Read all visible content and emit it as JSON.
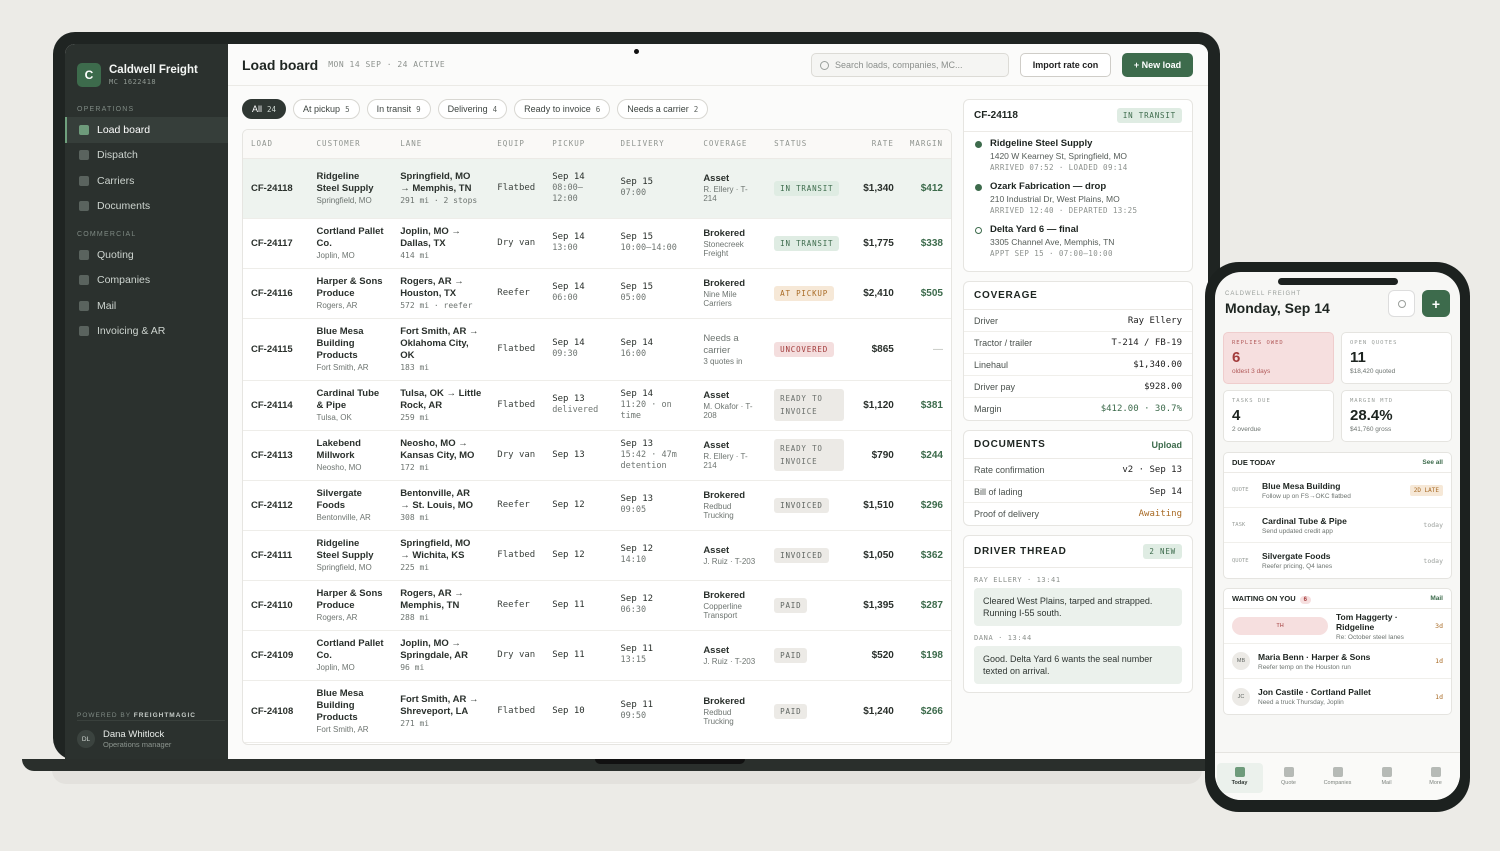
{
  "brand": {
    "name": "Caldwell Freight",
    "sub": "MC 1622418",
    "logo": "C"
  },
  "sidebar": {
    "sections": [
      {
        "label": "OPERATIONS",
        "items": [
          {
            "label": "Load board",
            "active": true
          },
          {
            "label": "Dispatch"
          },
          {
            "label": "Carriers"
          },
          {
            "label": "Documents"
          }
        ]
      },
      {
        "label": "COMMERCIAL",
        "items": [
          {
            "label": "Quoting"
          },
          {
            "label": "Companies"
          },
          {
            "label": "Mail"
          },
          {
            "label": "Invoicing & AR"
          }
        ]
      }
    ],
    "powered_prefix": "POWERED BY",
    "powered_name": "FREIGHTMAGIC",
    "user": {
      "initials": "DL",
      "name": "Dana Whitlock",
      "role": "Operations manager"
    }
  },
  "header": {
    "title": "Load board",
    "meta": "MON 14 SEP · 24 ACTIVE",
    "search_placeholder": "Search loads, companies, MC...",
    "import_label": "Import rate con",
    "new_label": "+ New load"
  },
  "filters": [
    {
      "label": "All",
      "count": "24",
      "active": true
    },
    {
      "label": "At pickup",
      "count": "5"
    },
    {
      "label": "In transit",
      "count": "9"
    },
    {
      "label": "Delivering",
      "count": "4"
    },
    {
      "label": "Ready to invoice",
      "count": "6"
    },
    {
      "label": "Needs a carrier",
      "count": "2"
    }
  ],
  "table": {
    "columns": [
      "LOAD",
      "CUSTOMER",
      "LANE",
      "EQUIP",
      "PICKUP",
      "DELIVERY",
      "COVERAGE",
      "STATUS",
      "RATE",
      "MARGIN"
    ],
    "rows": [
      {
        "id": "CF-24118",
        "customer": "Ridgeline Steel Supply",
        "city": "Springfield, MO",
        "lane": "Springfield, MO → Memphis, TN",
        "lane_sub": "291 mi · 2 stops",
        "equip": "Flatbed",
        "pickup": "Sep 14",
        "pickup_sub": "08:00–12:00",
        "delivery": "Sep 15",
        "delivery_sub": "07:00",
        "coverage": "Asset",
        "coverage_sub": "R. Ellery · T-214",
        "status": "IN TRANSIT",
        "status_kind": "transit",
        "rate": "$1,340",
        "margin": "$412",
        "selected": true
      },
      {
        "id": "CF-24117",
        "customer": "Cortland Pallet Co.",
        "city": "Joplin, MO",
        "lane": "Joplin, MO → Dallas, TX",
        "lane_sub": "414 mi",
        "equip": "Dry van",
        "pickup": "Sep 14",
        "pickup_sub": "13:00",
        "delivery": "Sep 15",
        "delivery_sub": "10:00–14:00",
        "coverage": "Brokered",
        "coverage_sub": "Stonecreek Freight",
        "status": "IN TRANSIT",
        "status_kind": "transit",
        "rate": "$1,775",
        "margin": "$338"
      },
      {
        "id": "CF-24116",
        "customer": "Harper & Sons Produce",
        "city": "Rogers, AR",
        "lane": "Rogers, AR → Houston, TX",
        "lane_sub": "572 mi · reefer",
        "equip": "Reefer",
        "pickup": "Sep 14",
        "pickup_sub": "06:00",
        "delivery": "Sep 15",
        "delivery_sub": "05:00",
        "coverage": "Brokered",
        "coverage_sub": "Nine Mile Carriers",
        "status": "AT PICKUP",
        "status_kind": "pickup",
        "rate": "$2,410",
        "margin": "$505"
      },
      {
        "id": "CF-24115",
        "customer": "Blue Mesa Building Products",
        "city": "Fort Smith, AR",
        "lane": "Fort Smith, AR → Oklahoma City, OK",
        "lane_sub": "183 mi",
        "equip": "Flatbed",
        "pickup": "Sep 14",
        "pickup_sub": "09:30",
        "delivery": "Sep 14",
        "delivery_sub": "16:00",
        "coverage": "Needs a carrier",
        "coverage_sub": "3 quotes in",
        "coverage_needs": true,
        "status": "UNCOVERED",
        "status_kind": "uncov",
        "rate": "$865",
        "margin": "—",
        "margin_na": true
      },
      {
        "id": "CF-24114",
        "customer": "Cardinal Tube & Pipe",
        "city": "Tulsa, OK",
        "lane": "Tulsa, OK → Little Rock, AR",
        "lane_sub": "259 mi",
        "equip": "Flatbed",
        "pickup": "Sep 13",
        "pickup_sub": "delivered",
        "delivery": "Sep 14",
        "delivery_sub": "11:20 · on time",
        "coverage": "Asset",
        "coverage_sub": "M. Okafor · T-208",
        "status": "READY TO INVOICE",
        "status_kind": "ready",
        "rate": "$1,120",
        "margin": "$381"
      },
      {
        "id": "CF-24113",
        "customer": "Lakebend Millwork",
        "city": "Neosho, MO",
        "lane": "Neosho, MO → Kansas City, MO",
        "lane_sub": "172 mi",
        "equip": "Dry van",
        "pickup": "Sep 13",
        "pickup_sub": "",
        "delivery": "Sep 13",
        "delivery_sub": "15:42 · 47m detention",
        "coverage": "Asset",
        "coverage_sub": "R. Ellery · T-214",
        "status": "READY TO INVOICE",
        "status_kind": "ready",
        "rate": "$790",
        "margin": "$244"
      },
      {
        "id": "CF-24112",
        "customer": "Silvergate Foods",
        "city": "Bentonville, AR",
        "lane": "Bentonville, AR → St. Louis, MO",
        "lane_sub": "308 mi",
        "equip": "Reefer",
        "pickup": "Sep 12",
        "pickup_sub": "",
        "delivery": "Sep 13",
        "delivery_sub": "09:05",
        "coverage": "Brokered",
        "coverage_sub": "Redbud Trucking",
        "status": "INVOICED",
        "status_kind": "inv",
        "rate": "$1,510",
        "margin": "$296"
      },
      {
        "id": "CF-24111",
        "customer": "Ridgeline Steel Supply",
        "city": "Springfield, MO",
        "lane": "Springfield, MO → Wichita, KS",
        "lane_sub": "225 mi",
        "equip": "Flatbed",
        "pickup": "Sep 12",
        "pickup_sub": "",
        "delivery": "Sep 12",
        "delivery_sub": "14:10",
        "coverage": "Asset",
        "coverage_sub": "J. Ruiz · T-203",
        "status": "INVOICED",
        "status_kind": "inv",
        "rate": "$1,050",
        "margin": "$362"
      },
      {
        "id": "CF-24110",
        "customer": "Harper & Sons Produce",
        "city": "Rogers, AR",
        "lane": "Rogers, AR → Memphis, TN",
        "lane_sub": "288 mi",
        "equip": "Reefer",
        "pickup": "Sep 11",
        "pickup_sub": "",
        "delivery": "Sep 12",
        "delivery_sub": "06:30",
        "coverage": "Brokered",
        "coverage_sub": "Copperline Transport",
        "status": "PAID",
        "status_kind": "paid",
        "rate": "$1,395",
        "margin": "$287"
      },
      {
        "id": "CF-24109",
        "customer": "Cortland Pallet Co.",
        "city": "Joplin, MO",
        "lane": "Joplin, MO → Springdale, AR",
        "lane_sub": "96 mi",
        "equip": "Dry van",
        "pickup": "Sep 11",
        "pickup_sub": "",
        "delivery": "Sep 11",
        "delivery_sub": "13:15",
        "coverage": "Asset",
        "coverage_sub": "J. Ruiz · T-203",
        "status": "PAID",
        "status_kind": "paid",
        "rate": "$520",
        "margin": "$198"
      },
      {
        "id": "CF-24108",
        "customer": "Blue Mesa Building Products",
        "city": "Fort Smith, AR",
        "lane": "Fort Smith, AR → Shreveport, LA",
        "lane_sub": "271 mi",
        "equip": "Flatbed",
        "pickup": "Sep 10",
        "pickup_sub": "",
        "delivery": "Sep 11",
        "delivery_sub": "09:50",
        "coverage": "Brokered",
        "coverage_sub": "Redbud Trucking",
        "status": "PAID",
        "status_kind": "paid",
        "rate": "$1,240",
        "margin": "$266"
      }
    ]
  },
  "detail": {
    "load_id": "CF-24118",
    "status": "IN TRANSIT",
    "stops": [
      {
        "name": "Ridgeline Steel Supply",
        "addr": "1420 W Kearney St, Springfield, MO",
        "time": "ARRIVED 07:52 · LOADED 09:14",
        "done": true
      },
      {
        "name": "Ozark Fabrication — drop",
        "addr": "210 Industrial Dr, West Plains, MO",
        "time": "ARRIVED 12:40 · DEPARTED 13:25",
        "done": true
      },
      {
        "name": "Delta Yard 6 — final",
        "addr": "3305 Channel Ave, Memphis, TN",
        "time": "APPT SEP 15 · 07:00–10:00",
        "done": false
      }
    ],
    "coverage_title": "COVERAGE",
    "coverage": [
      {
        "k": "Driver",
        "v": "Ray Ellery"
      },
      {
        "k": "Tractor / trailer",
        "v": "T-214 / FB-19"
      },
      {
        "k": "Linehaul",
        "v": "$1,340.00"
      },
      {
        "k": "Driver pay",
        "v": "$928.00"
      },
      {
        "k": "Margin",
        "v": "$412.00 · 30.7%",
        "green": true
      }
    ],
    "documents_title": "DOCUMENTS",
    "upload_label": "Upload",
    "documents": [
      {
        "k": "Rate confirmation",
        "v": "v2 · Sep 13"
      },
      {
        "k": "Bill of lading",
        "v": "Sep 14"
      },
      {
        "k": "Proof of delivery",
        "v": "Awaiting",
        "amber": true
      }
    ],
    "thread_title": "DRIVER THREAD",
    "thread_badge": "2 NEW",
    "messages": [
      {
        "from": "RAY ELLERY · 13:41",
        "text": "Cleared West Plains, tarped and strapped. Running I-55 south."
      },
      {
        "from": "DANA · 13:44",
        "text": "Good. Delta Yard 6 wants the seal number texted on arrival."
      }
    ]
  },
  "phone": {
    "org": "CALDWELL FREIGHT",
    "title": "Monday, Sep 14",
    "plus": "+",
    "stats": [
      {
        "label": "REPLIES OWED",
        "value": "6",
        "sub": "oldest 3 days",
        "alert": true
      },
      {
        "label": "OPEN QUOTES",
        "value": "11",
        "sub": "$18,420 quoted"
      },
      {
        "label": "TASKS DUE",
        "value": "4",
        "sub": "2 overdue"
      },
      {
        "label": "MARGIN MTD",
        "value": "28.4%",
        "sub": "$41,760 gross"
      }
    ],
    "due_title": "DUE TODAY",
    "due_link": "See all",
    "due": [
      {
        "tag": "QUOTE",
        "title": "Blue Mesa Building",
        "sub": "Follow up on FS→OKC flatbed",
        "right": "2D LATE",
        "late": true
      },
      {
        "tag": "TASK",
        "title": "Cardinal Tube & Pipe",
        "sub": "Send updated credit app",
        "right": "today"
      },
      {
        "tag": "QUOTE",
        "title": "Silvergate Foods",
        "sub": "Reefer pricing, Q4 lanes",
        "right": "today"
      }
    ],
    "waiting_title": "WAITING ON YOU",
    "waiting_count": "6",
    "waiting_link": "Mail",
    "waiting": [
      {
        "initials": "TH",
        "title": "Tom Haggerty · Ridgeline",
        "sub": "Re: October steel lanes",
        "right": "3d",
        "wide": true
      },
      {
        "initials": "MB",
        "title": "Maria Benn · Harper & Sons",
        "sub": "Reefer temp on the Houston run",
        "right": "1d"
      },
      {
        "initials": "JC",
        "title": "Jon Castile · Cortland Pallet",
        "sub": "Need a truck Thursday, Joplin",
        "right": "1d"
      }
    ],
    "tabs": [
      {
        "label": "Today",
        "active": true
      },
      {
        "label": "Quote"
      },
      {
        "label": "Companies"
      },
      {
        "label": "Mail"
      },
      {
        "label": "More"
      }
    ]
  }
}
